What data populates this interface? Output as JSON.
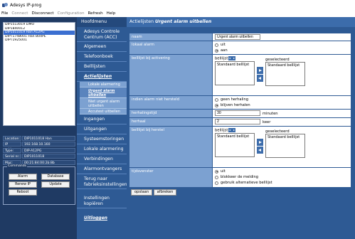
{
  "window": {
    "title": "Adesys IP-prog"
  },
  "menu": {
    "file": "File",
    "connect": "Connect",
    "disconnect": "Disconnect",
    "configuration": "Configuration",
    "refresh": "Refresh",
    "help": "Help"
  },
  "devices": [
    "DIP1513019 LIMO",
    "DIP1840012",
    "DIP1011019 Han A12PG",
    "DIPT1748001 Han B04PE",
    "DIPT1925001"
  ],
  "selected_device_index": 2,
  "info": {
    "location_label": "Location:",
    "location_value": "DIP1011018 Han",
    "ip_label": "IP address:",
    "ip_value": "192.168.10.160",
    "type_label": "Type:",
    "type_value": "DIP-A12PG",
    "serial_label": "Serial nr.:",
    "serial_value": "DIP1011018",
    "mac_label": "Mac:",
    "mac_value": "00:21:84:00:2b:8b"
  },
  "commands": {
    "legend": "Commands",
    "alarm": "Alarm",
    "database": "Database",
    "renew_ip": "Renew IP",
    "update": "Update",
    "reboot": "Reboot"
  },
  "nav": {
    "header": "Hoofdmenu",
    "acc": "Adesys Controle Centrum (ACC)",
    "algemeen": "Algemeen",
    "telefoonboek": "Telefoonboek",
    "belllijsten": "Belllijsten",
    "actielijsten": "Actielijsten",
    "sub_lokale": "Lokale alarmering",
    "sub_urgent": "Urgent alarm uitbellen",
    "sub_niet_urgent": "Niet urgent alarm uitbellen",
    "sub_accutest": "Accutest uitbellen",
    "ingangen": "Ingangen",
    "uitgangen": "Uitgangen",
    "systeemstoringen": "Systeemstoringen",
    "lokale_alarmering": "Lokale alarmering",
    "verbindingen": "Verbindingen",
    "alarmontvangers": "Alarmontvangers",
    "terug": "Terug naar fabrieksinstellingen",
    "instellingen": "Instellingen kopiëren",
    "uitloggen": "Uitloggen"
  },
  "breadcrumb": {
    "section": "Actielijsten",
    "current": "Urgent alarm uitbellen"
  },
  "form": {
    "naam_label": "naam",
    "naam_value": "Urgent alarm uitbellen",
    "lokaal_label": "lokaal alarm",
    "lokaal_options": [
      "uit",
      "aan"
    ],
    "lokaal_selected": 1,
    "activering_label": "belllijst bij activering",
    "belllijst_label": "belllijst",
    "geselecteerd_label": "geselecteerd",
    "activering_available": [
      "Standaard belllijst"
    ],
    "activering_selected": [
      "Standaard belllijst"
    ],
    "herstel_q_label": "indien alarm niet hersteld",
    "herstel_options": [
      "geen herhaling",
      "blijven herhalen"
    ],
    "herstel_selected": 1,
    "herhalingstijd_label": "herhalingstijd",
    "herhalingstijd_value": "30",
    "herhalingstijd_unit": "minuten",
    "herhaal_label": "herhaal",
    "herhaal_value": "2",
    "herhaal_unit": "keer",
    "herstel_label": "belllijst bij herstel",
    "herstel_available": [
      "Standaard belllijst"
    ],
    "herstel_selected_list": [
      "Standaard belllijst"
    ],
    "tijdsvenster_label": "tijdsvenster",
    "tijdsvenster_options": [
      "uit",
      "blokkeer de melding",
      "gebruik alternatieve belllijst"
    ],
    "tijdsvenster_selected": 0,
    "save_label": "opslaan",
    "cancel_label": "afbreken"
  }
}
